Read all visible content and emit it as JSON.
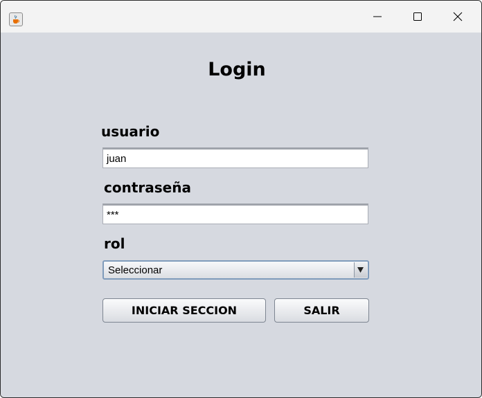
{
  "window": {
    "icon": "java-cup-icon",
    "controls": [
      "minimize-icon",
      "maximize-icon",
      "close-icon"
    ]
  },
  "form": {
    "title": "Login",
    "username_label": "usuario",
    "username_value": "juan",
    "password_label": "contraseña",
    "password_value": "***",
    "role_label": "rol",
    "role_selected": "Seleccionar",
    "login_button": "INICIAR SECCION",
    "exit_button": "SALIR"
  }
}
